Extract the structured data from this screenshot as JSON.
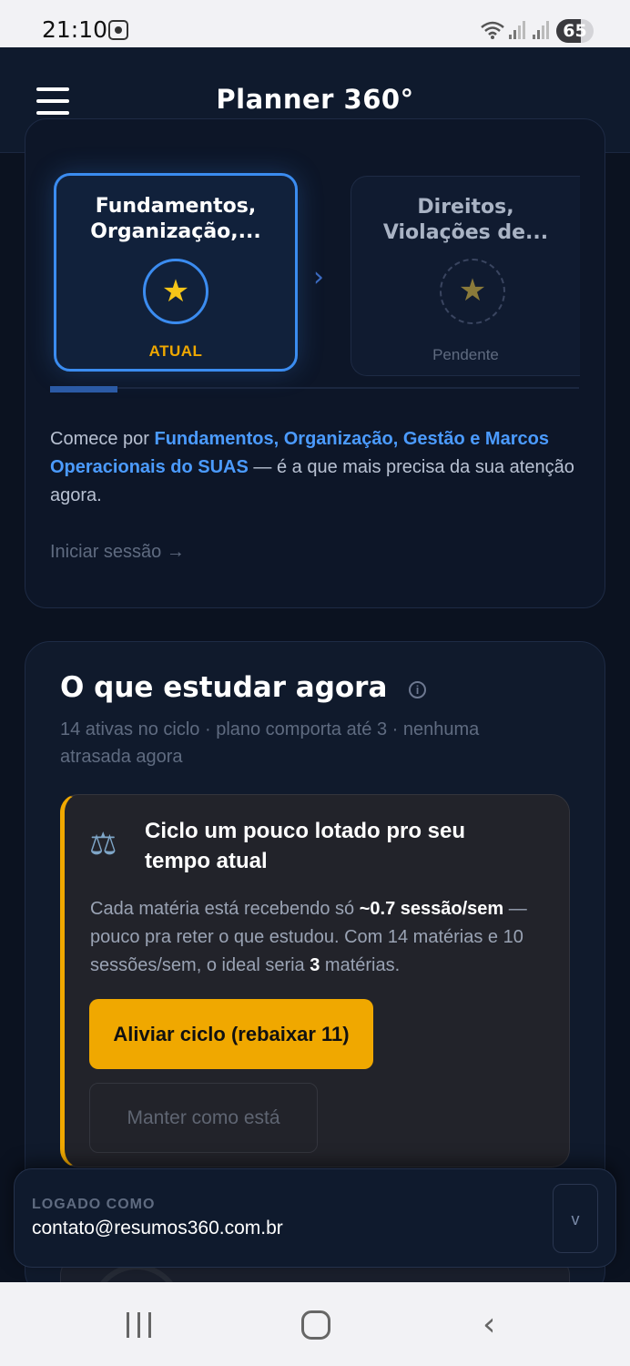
{
  "status_bar": {
    "time": "21:10",
    "battery": "65",
    "battery_level": 0.65
  },
  "app": {
    "title": "Planner 360°"
  },
  "topics": [
    {
      "title": "Fundamentos, Organização,...",
      "status": "ATUAL"
    },
    {
      "title": "Direitos, Violações de...",
      "status": "Pendente"
    }
  ],
  "recommendation": {
    "prefix": "Comece por ",
    "highlight": "Fundamentos, Organização, Gestão e Marcos Operacionais do SUAS",
    "suffix": " — é a que mais precisa da sua atenção agora.",
    "link": "Iniciar sessão →"
  },
  "study_now": {
    "title": "O que estudar agora",
    "subtitle": "14 ativas no ciclo · plano comporta até 3 · nenhuma atrasada agora"
  },
  "warning": {
    "icon": "scale-icon",
    "title": "Ciclo um pouco lotado pro seu tempo atual",
    "body_1": "Cada matéria está recebendo só ",
    "body_bold_1": "~0.7 sessão/sem",
    "body_2": " — pouco pra reter o que estudou. Com 14 matérias e 10 sessões/sem, o ideal seria ",
    "body_bold_2": "3",
    "body_3": " matérias.",
    "primary_action": "Aliviar ciclo (rebaixar 11)",
    "secondary_action": "Manter como está"
  },
  "account": {
    "label": "LOGADO COMO",
    "email": "contato@resumos360.com.br",
    "expand_glyph": "v"
  },
  "colors": {
    "accent_blue": "#3b8cf0",
    "accent_amber": "#f0a800",
    "background": "#0b1220"
  }
}
